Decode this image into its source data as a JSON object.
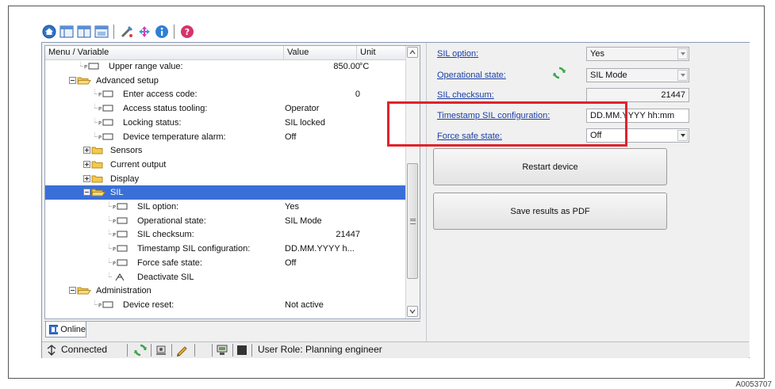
{
  "figure_id": "A0053707",
  "toolbar": {
    "icons": [
      "home-icon",
      "layout-icon",
      "window-icon",
      "panel-icon",
      "tools-icon",
      "arrows-icon",
      "info-icon",
      "help-icon"
    ]
  },
  "tree": {
    "columns": {
      "name": "Menu / Variable",
      "value": "Value",
      "unit": "Unit"
    },
    "rows": [
      {
        "label": "Upper range value:",
        "value": "850.00",
        "unit": "°C",
        "type": "param",
        "indent": 0
      },
      {
        "label": "Advanced setup",
        "value": "",
        "unit": "",
        "type": "folder-open",
        "indent": 0
      },
      {
        "label": "Enter access code:",
        "value": "0",
        "unit": "",
        "type": "param",
        "indent": 1
      },
      {
        "label": "Access status tooling:",
        "value": "Operator",
        "unit": "",
        "type": "param",
        "indent": 1
      },
      {
        "label": "Locking status:",
        "value": "SIL locked",
        "unit": "",
        "type": "param",
        "indent": 1
      },
      {
        "label": "Device temperature alarm:",
        "value": "Off",
        "unit": "",
        "type": "param",
        "indent": 1
      },
      {
        "label": "Sensors",
        "value": "",
        "unit": "",
        "type": "folder",
        "indent": 1
      },
      {
        "label": "Current output",
        "value": "",
        "unit": "",
        "type": "folder",
        "indent": 1
      },
      {
        "label": "Display",
        "value": "",
        "unit": "",
        "type": "folder",
        "indent": 1
      },
      {
        "label": "SIL",
        "value": "",
        "unit": "",
        "type": "folder-open",
        "indent": 1,
        "selected": true
      },
      {
        "label": "SIL option:",
        "value": "Yes",
        "unit": "",
        "type": "param",
        "indent": 2
      },
      {
        "label": "Operational state:",
        "value": "SIL Mode",
        "unit": "",
        "type": "param",
        "indent": 2
      },
      {
        "label": "SIL checksum:",
        "value": "21447",
        "unit": "",
        "type": "param",
        "indent": 2
      },
      {
        "label": "Timestamp SIL configuration:",
        "value": "DD.MM.YYYY h...",
        "unit": "",
        "type": "param",
        "indent": 2
      },
      {
        "label": "Force safe state:",
        "value": "Off",
        "unit": "",
        "type": "param",
        "indent": 2
      },
      {
        "label": "Deactivate SIL",
        "value": "",
        "unit": "",
        "type": "wizard",
        "indent": 2
      },
      {
        "label": "Administration",
        "value": "",
        "unit": "",
        "type": "folder-open",
        "indent": 0
      },
      {
        "label": "Device reset:",
        "value": "Not active",
        "unit": "",
        "type": "param",
        "indent": 1
      }
    ]
  },
  "right": {
    "fields": [
      {
        "label": "SIL option:",
        "value": "Yes",
        "kind": "select-disabled"
      },
      {
        "label": "Operational state:",
        "value": "SIL Mode",
        "kind": "select-disabled",
        "icon": "refresh-icon"
      },
      {
        "label": "SIL checksum:",
        "value": "21447",
        "kind": "number-readonly"
      },
      {
        "label": "Timestamp SIL configuration:",
        "value": "DD.MM.YYYY hh:mm",
        "kind": "text"
      },
      {
        "label": "Force safe state:",
        "value": "Off",
        "kind": "select"
      }
    ],
    "restart_button": "Restart device",
    "pdf_button": "Save results as PDF",
    "highlight_color": "#e1222a"
  },
  "tab": {
    "label": "Online"
  },
  "status": {
    "connection": "Connected",
    "role": "User Role: Planning engineer"
  }
}
